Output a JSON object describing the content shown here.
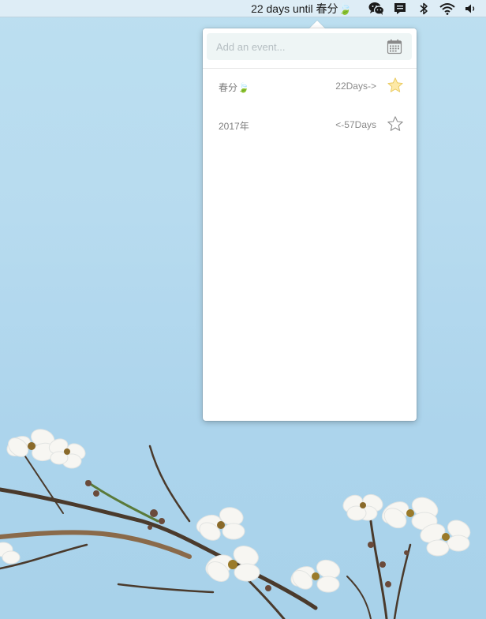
{
  "menubar": {
    "title": "22 days until 春分🍃",
    "icons": [
      "wechat-icon",
      "message-icon",
      "bluetooth-icon",
      "wifi-icon",
      "volume-icon"
    ]
  },
  "popover": {
    "input": {
      "placeholder": "Add an event...",
      "value": ""
    },
    "calendar_icon": "calendar-icon",
    "events": [
      {
        "name": "春分🍃",
        "days": "22Days->",
        "starred": true
      },
      {
        "name": "2017年",
        "days": "<-57Days",
        "starred": false
      }
    ]
  },
  "colors": {
    "star_filled": "#fde9a7",
    "star_filled_stroke": "#e8c85a",
    "star_outline": "#8f8f8f",
    "input_bg": "#eef5f5",
    "wallpaper": "#b7dbef"
  }
}
